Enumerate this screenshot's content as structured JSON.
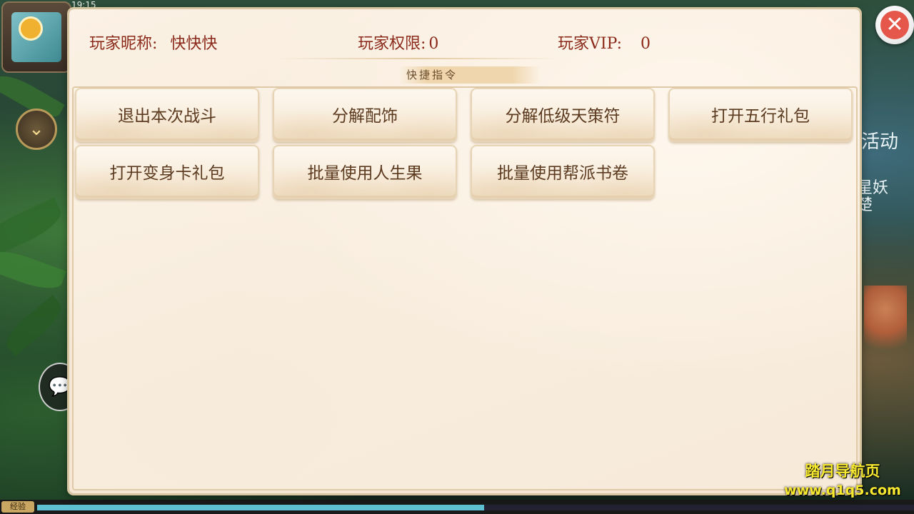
{
  "hud": {
    "time": "19:15",
    "activity_label": "活动",
    "event_label": "星妖\n楚",
    "exp_label": "经验",
    "exp_progress": 0.51
  },
  "dialog": {
    "player_name_label": "玩家昵称:",
    "player_name_value": "快快快",
    "permission_label": "玩家权限:",
    "permission_value": "0",
    "vip_label": "玩家VIP:",
    "vip_value": "0",
    "section_title": "快捷指令",
    "commands": [
      "退出本次战斗",
      "分解配饰",
      "分解低级天策符",
      "打开五行礼包",
      "打开变身卡礼包",
      "批量使用人生果",
      "批量使用帮派书卷"
    ],
    "close_symbol": "✕"
  },
  "watermark": {
    "line1": "踏月导航页",
    "line2": "www.q1q5.com"
  }
}
